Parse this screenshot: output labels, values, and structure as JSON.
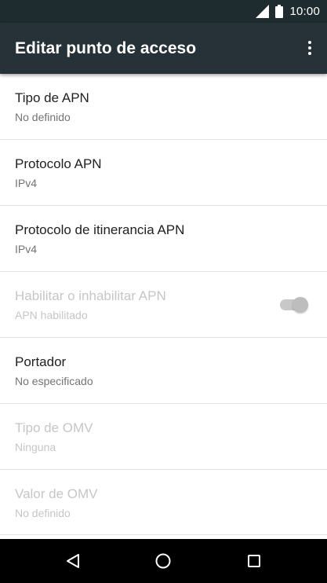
{
  "status_bar": {
    "time": "10:00",
    "icons": [
      "signal-icon",
      "battery-icon"
    ]
  },
  "toolbar": {
    "title": "Editar punto de acceso",
    "overflow_icon": "more-vert-icon"
  },
  "items": [
    {
      "title": "Tipo de APN",
      "summary": "No definido",
      "enabled": true
    },
    {
      "title": "Protocolo APN",
      "summary": "IPv4",
      "enabled": true
    },
    {
      "title": "Protocolo de itinerancia APN",
      "summary": "IPv4",
      "enabled": true
    },
    {
      "title": "Habilitar o inhabilitar APN",
      "summary": "APN habilitado",
      "enabled": false,
      "switch_on": true
    },
    {
      "title": "Portador",
      "summary": "No especificado",
      "enabled": true
    },
    {
      "title": "Tipo de OMV",
      "summary": "Ninguna",
      "enabled": false
    },
    {
      "title": "Valor de OMV",
      "summary": "No definido",
      "enabled": false
    }
  ],
  "nav_bar": {
    "icons": [
      "back-icon",
      "home-icon",
      "recents-icon"
    ]
  },
  "colors": {
    "status_bar_bg": "#1e2b2f",
    "toolbar_bg": "#263238",
    "nav_bar_bg": "#000000",
    "primary_text": "#212121",
    "secondary_text": "#737373",
    "disabled_text": "#c6c6c6",
    "divider": "#e3e3e3"
  }
}
